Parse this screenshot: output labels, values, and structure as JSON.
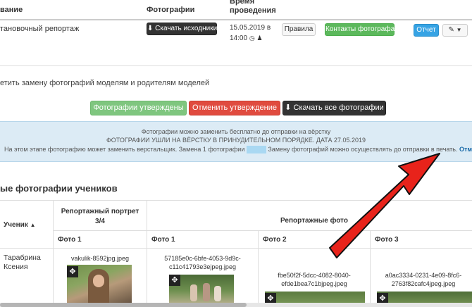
{
  "top_table": {
    "col_title": "вание",
    "col_photos": "Фотографии",
    "col_time_line1": "Время",
    "col_time_line2": "проведения",
    "row": {
      "title": "тановочный репортаж",
      "download_btn": "Скачать исходники",
      "date": "15.05.2019 в",
      "time": "14:00",
      "rules_btn": "Правила",
      "contacts_btn": "Контакты фотографа",
      "report_btn": "Отчет"
    }
  },
  "replace_notice": "етить замену фотографий моделям и родителям моделей",
  "actions": {
    "approved": "Фотографии утверждены",
    "cancel_approval": "Отменить утверждение",
    "download_all": "Скачать все фотографии"
  },
  "info_box": {
    "line1": "Фотографии можно заменить бесплатно до отправки на вёрстку",
    "line2": "ФОТОГРАФИИ УШЛИ НА ВЁРСТКУ В ПРИНУДИТЕЛЬНОМ ПОРЯДКЕ. ДАТА 27.05.2019",
    "line3_a": "На этом этапе фотографию может заменить верстальщик. Замена 1 фотографии",
    "line3_b": "Замену фотографий можно осуществлять до отправки в печать.",
    "cancel_link": "Отменить"
  },
  "section_title": "ые фотографии учеников",
  "students_table": {
    "col_student": "Ученик",
    "col_portrait_line1": "Репортажный портрет",
    "col_portrait_line2": "3/4",
    "col_report": "Репортажные фото",
    "sub_photo1a": "Фото 1",
    "sub_photo1b": "Фото 1",
    "sub_photo2": "Фото 2",
    "sub_photo3": "Фото 3",
    "student_name_line1": "Тарабрина",
    "student_name_line2": "Ксения",
    "files": {
      "portrait": "vakulik-8592jpg.jpeg",
      "photo1_l1": "57185e0c-6bfe-4053-9d9c-",
      "photo1_l2": "c11c41793e3ejpeg.jpeg",
      "photo2_l1": "fbe50f2f-5dcc-4082-8040-",
      "photo2_l2": "efde1bea7c1bjpeg.jpeg",
      "photo3_l1": "a0ac3334-0231-4e09-8fc6-",
      "photo3_l2": "2763f82cafc4jpeg.jpeg"
    }
  },
  "colors": {
    "accent_blue": "#36a3e4",
    "success_green": "#5cb85c",
    "danger_red": "#e04b3f",
    "info_bg": "#dcebf5",
    "arrow_red": "#e8231b"
  }
}
